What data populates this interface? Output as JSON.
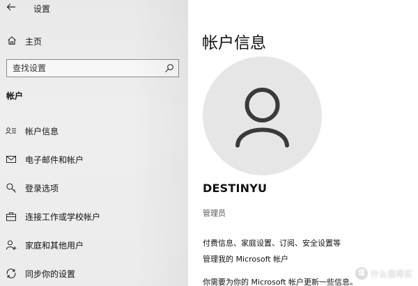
{
  "window": {
    "title": "设置"
  },
  "sidebar": {
    "home_label": "主页",
    "search_placeholder": "查找设置",
    "section_title": "帐户",
    "items": [
      {
        "label": "帐户信息",
        "icon": "account-info-icon"
      },
      {
        "label": "电子邮件和帐户",
        "icon": "email-icon"
      },
      {
        "label": "登录选项",
        "icon": "key-icon"
      },
      {
        "label": "连接工作或学校帐户",
        "icon": "briefcase-icon"
      },
      {
        "label": "家庭和其他用户",
        "icon": "person-add-icon"
      },
      {
        "label": "同步你的设置",
        "icon": "sync-icon"
      }
    ]
  },
  "main": {
    "title": "帐户信息",
    "user_name": "DESTINYU",
    "role": "管理员",
    "info_lines": [
      "付费信息、家庭设置、订阅、安全设置等",
      "管理我的 Microsoft 帐户",
      "你需要为你的 Microsoft 帐户更新一些信息。"
    ]
  },
  "watermark": {
    "text": "什么值得买",
    "logo": "值"
  },
  "colors": {
    "sidebar_bg": "#e9e9e9",
    "main_bg": "#ffffff",
    "avatar_bg": "#e6e6e6",
    "avatar_fg": "#3a3a3a",
    "text": "#111111"
  }
}
